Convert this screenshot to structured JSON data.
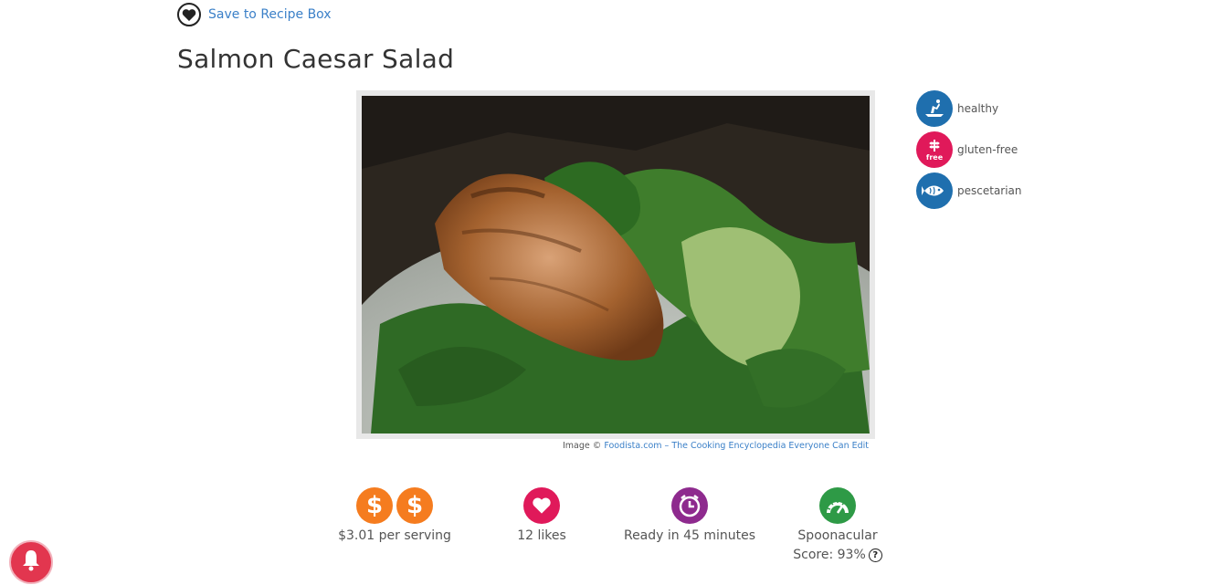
{
  "header": {
    "save_label": "Save to Recipe Box",
    "title": "Salmon Caesar Salad"
  },
  "image": {
    "credit_prefix": "Image ©",
    "credit_link": "Foodista.com – The Cooking Encyclopedia Everyone Can Edit"
  },
  "diets": [
    {
      "label": "healthy",
      "icon": "healthy-icon",
      "color": "#1f6fae"
    },
    {
      "label": "gluten-free",
      "icon": "gluten-free-icon",
      "color": "#e0195a",
      "icon_text": "free"
    },
    {
      "label": "pescetarian",
      "icon": "fish-icon",
      "color": "#1f6fae"
    }
  ],
  "stats": {
    "price": {
      "text": "$3.01 per serving",
      "icon": "dollar-icon",
      "color": "#f57c1f",
      "glyph": "$"
    },
    "likes": {
      "text": "12 likes",
      "icon": "heart-icon",
      "color": "#e0195a"
    },
    "time": {
      "text": "Ready in 45 minutes",
      "icon": "clock-icon",
      "color": "#8e2a8e"
    },
    "score": {
      "line1": "Spoonacular",
      "line2": "Score: 93%",
      "help": "?",
      "icon": "gauge-icon",
      "color": "#2e9a46"
    }
  }
}
